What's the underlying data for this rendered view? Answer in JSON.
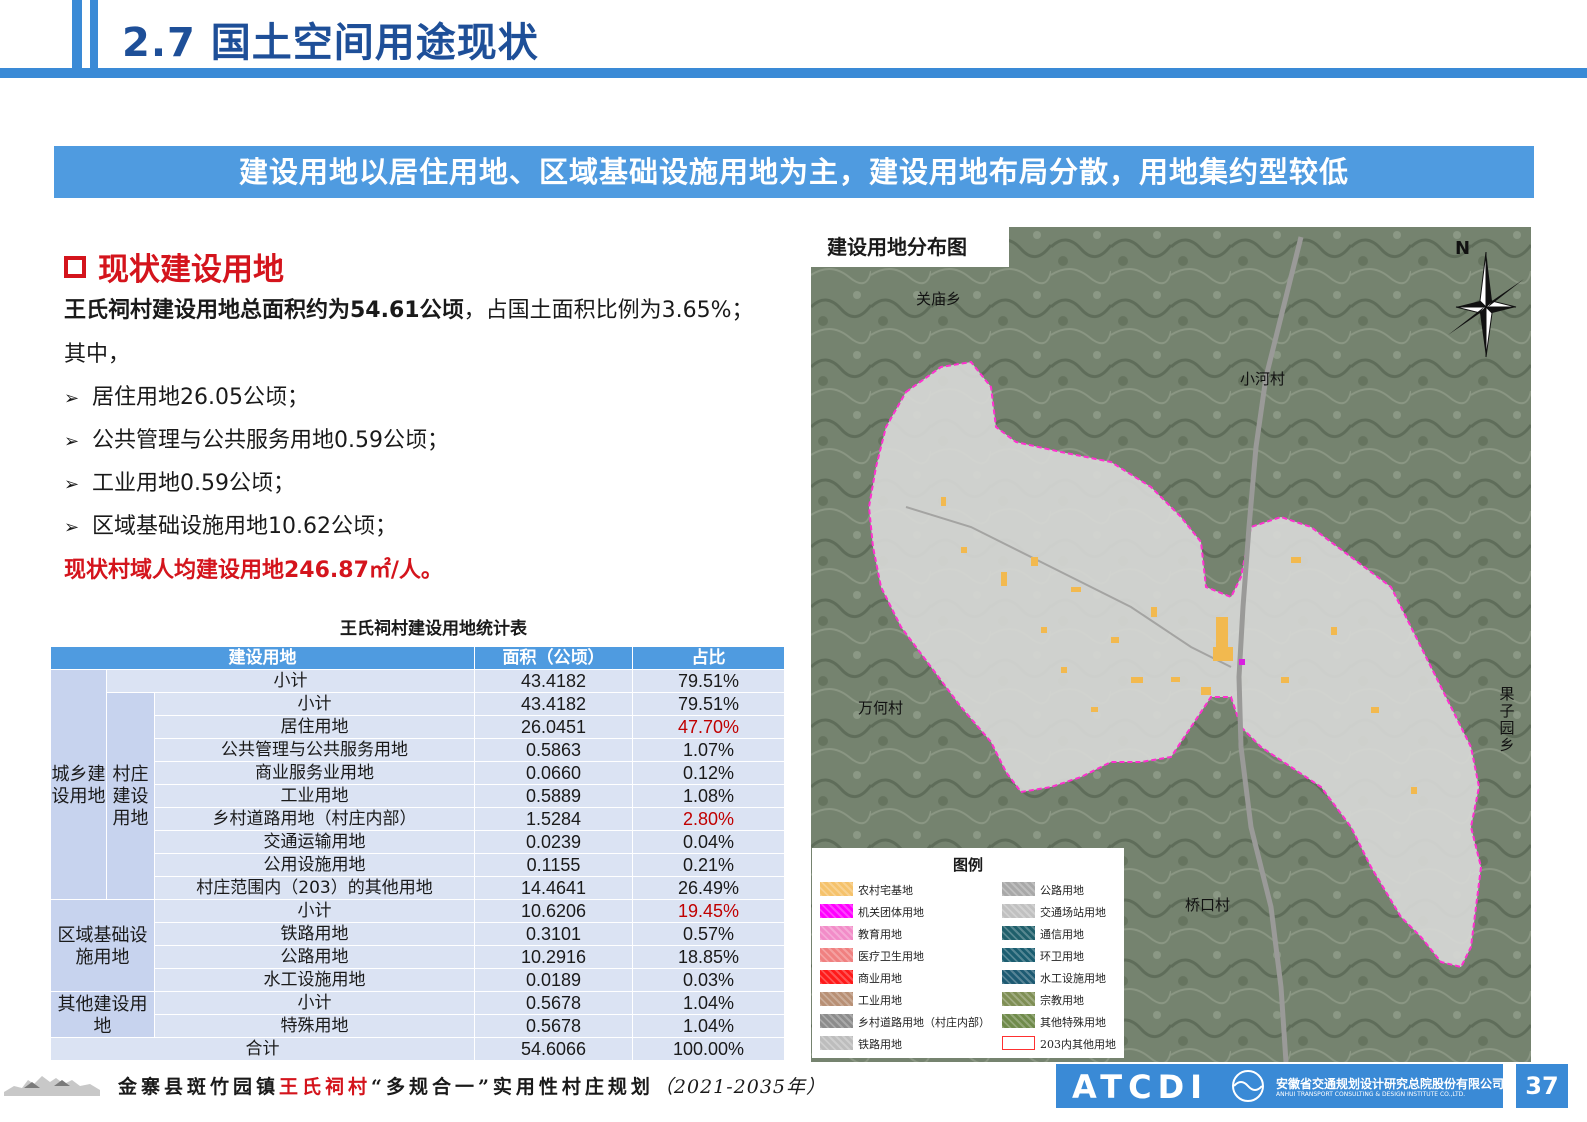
{
  "header": {
    "title": "2.7 国土空间用途现状"
  },
  "banner": "建设用地以居住用地、区域基础设施用地为主，建设用地布局分散，用地集约型较低",
  "section": {
    "title": "现状建设用地",
    "intro_bold": "王氏祠村建设用地总面积约为54.61公顷",
    "intro_rest": "，占国土面积比例为3.65%；",
    "intro_line2": "其中，",
    "bullets": [
      "居住用地26.05公顷；",
      "公共管理与公共服务用地0.59公顷；",
      "工业用地0.59公顷；",
      "区域基础设施用地10.62公顷；"
    ],
    "per_capita": "现状村域人均建设用地246.87㎡/人。"
  },
  "table": {
    "title": "王氏祠村建设用地统计表",
    "headers": [
      "建设用地",
      "面积（公顷）",
      "占比"
    ],
    "groups": {
      "urban_rural": "城乡建设用地",
      "village": "村庄建设用地",
      "regional": "区域基础设施用地",
      "other": "其他建设用地"
    },
    "rows": [
      {
        "label": "小计",
        "area": "43.4182",
        "pct": "79.51%"
      },
      {
        "label": "小计",
        "area": "43.4182",
        "pct": "79.51%"
      },
      {
        "label": "居住用地",
        "area": "26.0451",
        "pct": "47.70%"
      },
      {
        "label": "公共管理与公共服务用地",
        "area": "0.5863",
        "pct": "1.07%"
      },
      {
        "label": "商业服务业用地",
        "area": "0.0660",
        "pct": "0.12%"
      },
      {
        "label": "工业用地",
        "area": "0.5889",
        "pct": "1.08%"
      },
      {
        "label": "乡村道路用地（村庄内部）",
        "area": "1.5284",
        "pct": "2.80%"
      },
      {
        "label": "交通运输用地",
        "area": "0.0239",
        "pct": "0.04%"
      },
      {
        "label": "公用设施用地",
        "area": "0.1155",
        "pct": "0.21%"
      },
      {
        "label": "村庄范围内（203）的其他用地",
        "area": "14.4641",
        "pct": "26.49%"
      },
      {
        "label": "小计",
        "area": "10.6206",
        "pct": "19.45%"
      },
      {
        "label": "铁路用地",
        "area": "0.3101",
        "pct": "0.57%"
      },
      {
        "label": "公路用地",
        "area": "10.2916",
        "pct": "18.85%"
      },
      {
        "label": "水工设施用地",
        "area": "0.0189",
        "pct": "0.03%"
      },
      {
        "label": "小计",
        "area": "0.5678",
        "pct": "1.04%"
      },
      {
        "label": "特殊用地",
        "area": "0.5678",
        "pct": "1.04%"
      },
      {
        "label": "合计",
        "area": "54.6066",
        "pct": "100.00%"
      }
    ],
    "highlight_color": "#c00000"
  },
  "map": {
    "title": "建设用地分布图",
    "north": "N",
    "places": {
      "guanmiao": "关庙乡",
      "xiaohe": "小河村",
      "wanhe": "万何村",
      "guoziyuan": "果子园乡",
      "qiaokou": "桥口村"
    },
    "legend_title": "图例",
    "legend": [
      {
        "label": "农村宅基地",
        "color": "#f5c26b"
      },
      {
        "label": "机关团体用地",
        "color": "#ff00ff"
      },
      {
        "label": "教育用地",
        "color": "#f28cc8"
      },
      {
        "label": "医疗卫生用地",
        "color": "#f08080"
      },
      {
        "label": "商业用地",
        "color": "#ff1a1a"
      },
      {
        "label": "工业用地",
        "color": "#b89075"
      },
      {
        "label": "乡村道路用地（村庄内部）",
        "color": "#8c8c8c"
      },
      {
        "label": "铁路用地",
        "color": "#bdbdbd"
      },
      {
        "label": "公路用地",
        "color": "#a8a8a8"
      },
      {
        "label": "交通场站用地",
        "color": "#c0c0c0"
      },
      {
        "label": "通信用地",
        "color": "#1f5f6b"
      },
      {
        "label": "环卫用地",
        "color": "#1a5d70"
      },
      {
        "label": "水工设施用地",
        "color": "#1d5a72"
      },
      {
        "label": "宗教用地",
        "color": "#7f8f55"
      },
      {
        "label": "其他特殊用地",
        "color": "#6f8a4a"
      },
      {
        "label": "203内其他用地",
        "color": "#ffffff"
      }
    ]
  },
  "footer": {
    "text_a": "金寨县斑竹园镇",
    "text_b": "王氏祠村",
    "text_c": "“多规合一”实用性村庄规划",
    "text_d": "（2021-2035年）",
    "company_logo": "ATCDI",
    "company_cn": "安徽省交通规划设计研究总院股份有限公司",
    "company_en": "ANHUI TRANSPORT CONSULTING & DESIGN INSTITUTE CO.,LTD.",
    "page": "37"
  }
}
